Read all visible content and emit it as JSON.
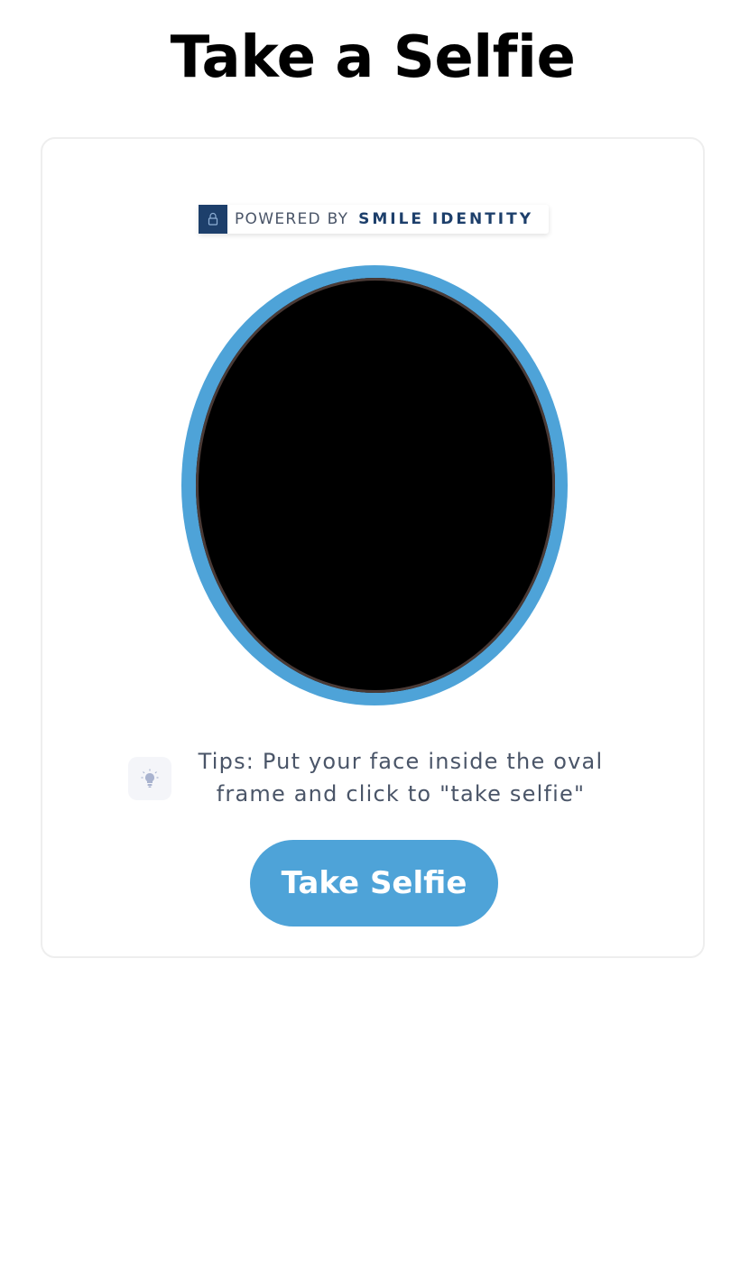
{
  "header": {
    "title": "Take a Selfie"
  },
  "badge": {
    "prefix": "POWERED BY",
    "brand": "SMILE IDENTITY",
    "icon": "lock-icon"
  },
  "camera": {
    "frame_color": "#4ea3d8"
  },
  "tips": {
    "icon": "lightbulb-icon",
    "text": "Tips: Put your face inside the oval frame and click to \"take selfie\""
  },
  "actions": {
    "take_selfie_label": "Take Selfie"
  },
  "colors": {
    "accent": "#4ea3d8",
    "brand": "#1d3f6b",
    "text_muted": "#4a5568"
  }
}
